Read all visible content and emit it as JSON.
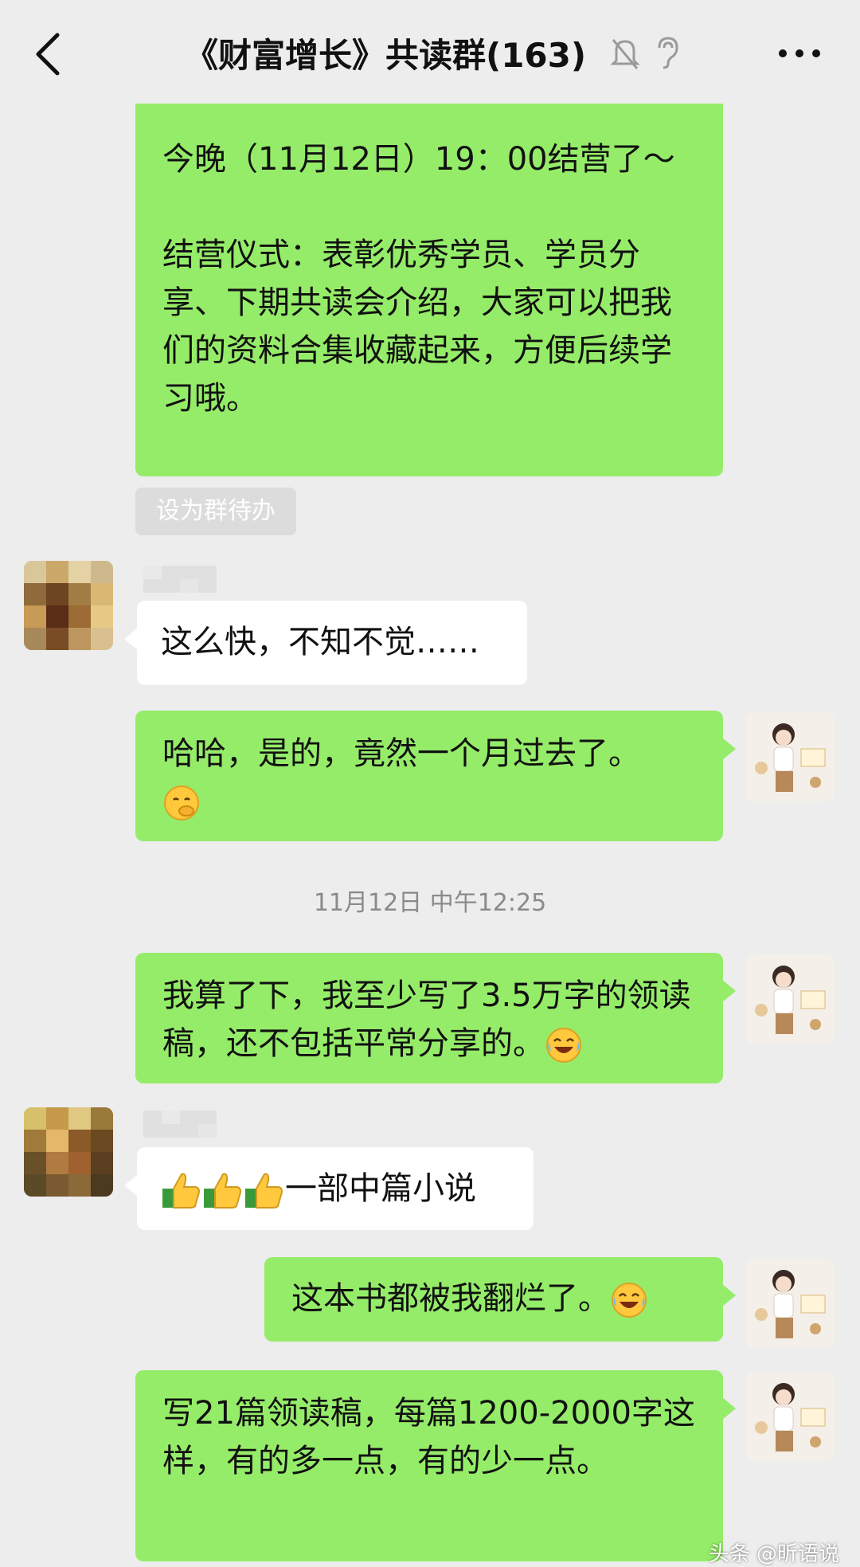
{
  "header": {
    "title": "《财富增长》共读群(163)"
  },
  "messages": {
    "m1": "今晚（11月12日）19：00结营了～\n\n结营仪式：表彰优秀学员、学员分享、下期共读会介绍，大家可以把我们的资料合集收藏起来，方便后续学习哦。",
    "todo_chip": "设为群待办",
    "m2": "这么快，不知不觉……",
    "m3": "哈哈，是的，竟然一个月过去了。",
    "timestamp": "11月12日 中午12:25",
    "m4": "我算了下，我至少写了3.5万字的领读稿，还不包括平常分享的。",
    "m5": "一部中篇小说",
    "m6": "这本书都被我翻烂了。",
    "m7": "写21篇领读稿，每篇1200-2000字这样，有的多一点，有的少一点。"
  },
  "watermark": "头条 @昕语说",
  "colors": {
    "background": "#ededed",
    "my_bubble": "#95ec69",
    "other_bubble": "#ffffff",
    "timestamp_text": "#8a8a8a"
  },
  "icons": [
    "back-icon",
    "mute-bell-icon",
    "ear-icon",
    "more-icon",
    "shy-face-emoji",
    "laugh-cry-emoji",
    "thumbs-up-emoji"
  ]
}
